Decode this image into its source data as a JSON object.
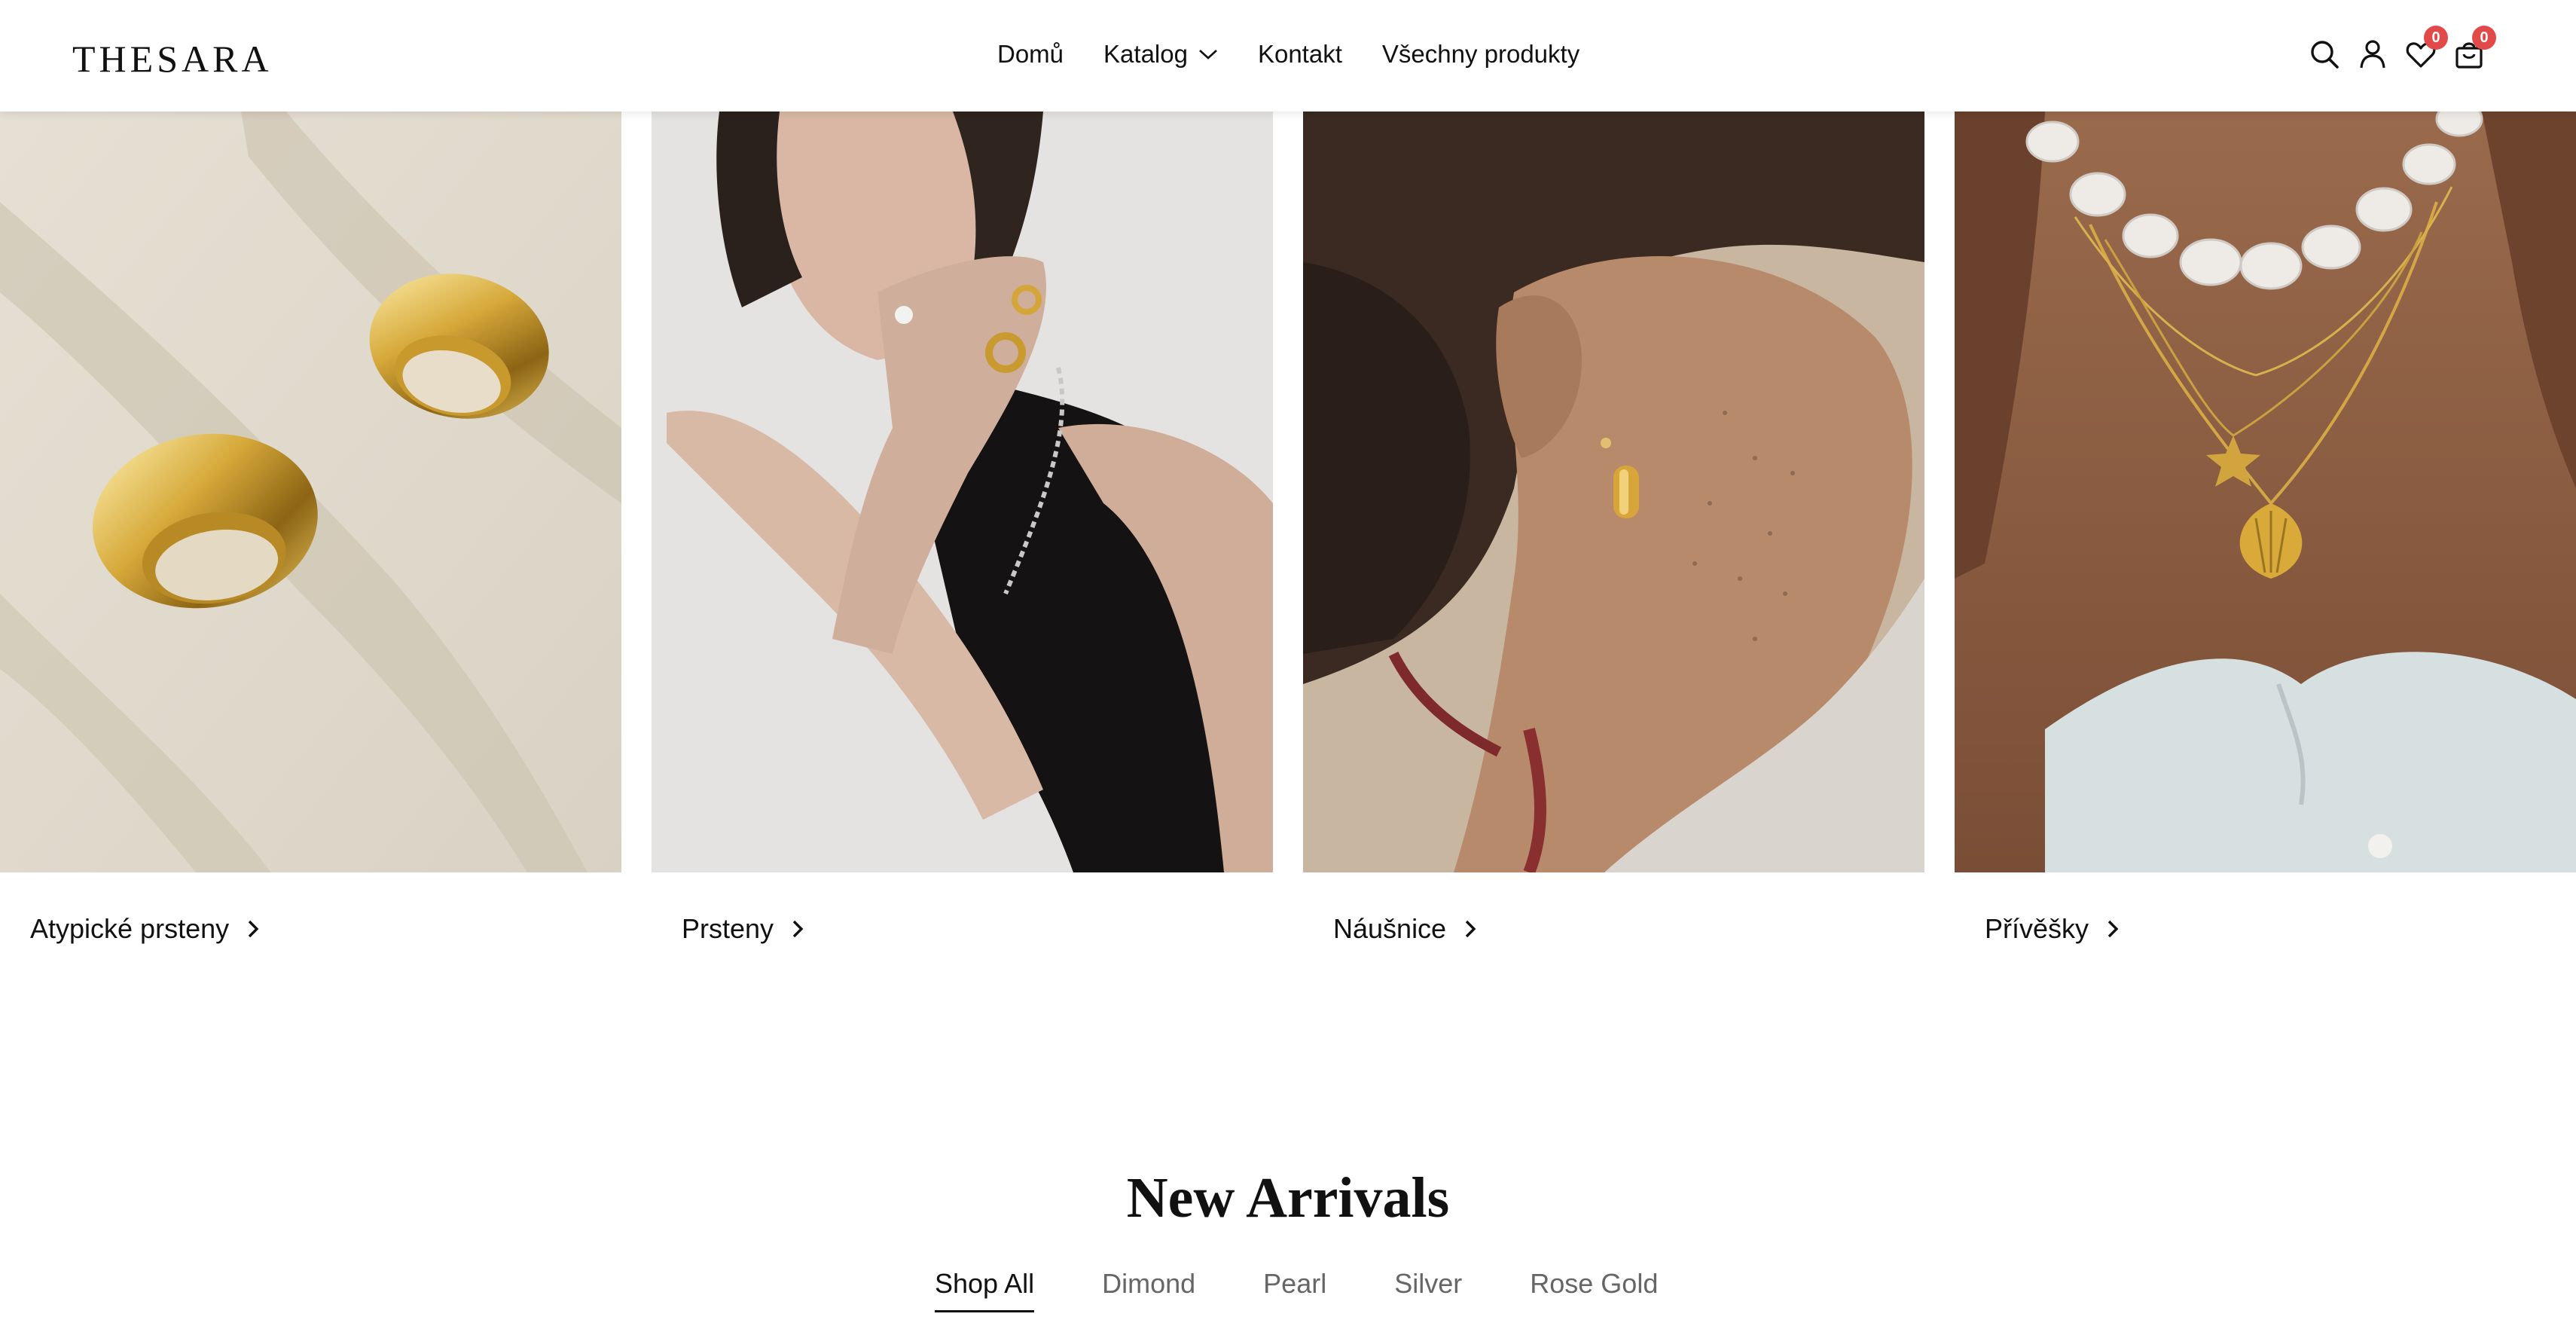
{
  "header": {
    "logo": "THESARA",
    "nav": [
      {
        "label": "Domů"
      },
      {
        "label": "Katalog",
        "has_dropdown": true
      },
      {
        "label": "Kontakt"
      },
      {
        "label": "Všechny produkty"
      }
    ],
    "icons": [
      "search-icon",
      "account-icon",
      "wishlist-icon",
      "cart-icon"
    ],
    "wishlist_count": "0",
    "cart_count": "0",
    "badge_color": "#e24a4a"
  },
  "categories": [
    {
      "label": "Atypické prsteny",
      "image": "gold cuff rings on sand"
    },
    {
      "label": "Prsteny",
      "image": "model wearing gold rings"
    },
    {
      "label": "Náušnice",
      "image": "woman wearing gold earrings"
    },
    {
      "label": "Přívěšky",
      "image": "pearl and gold pendant necklaces"
    }
  ],
  "new_arrivals": {
    "title": "New Arrivals",
    "tabs": [
      {
        "label": "Shop All",
        "active": true
      },
      {
        "label": "Dimond",
        "active": false
      },
      {
        "label": "Pearl",
        "active": false
      },
      {
        "label": "Silver",
        "active": false
      },
      {
        "label": "Rose Gold",
        "active": false
      }
    ]
  }
}
